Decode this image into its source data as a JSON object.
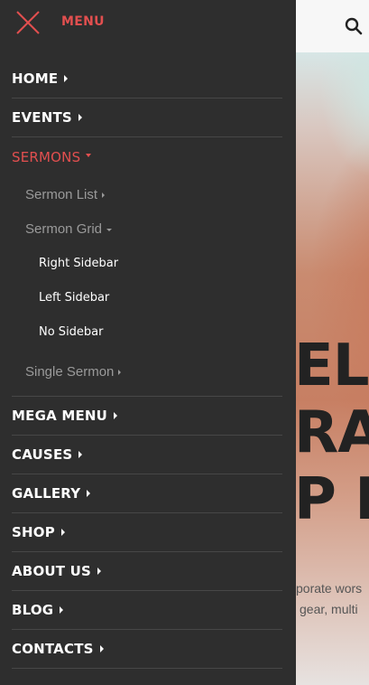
{
  "menu": {
    "title": "MENU",
    "accent_color": "#e24f4f",
    "background_color": "#2e2e2e",
    "close_icon": "close-icon",
    "items": [
      {
        "label": "HOME"
      },
      {
        "label": "EVENTS"
      },
      {
        "label": "SERMONS",
        "expanded": true,
        "children": [
          {
            "label": "Sermon List"
          },
          {
            "label": "Sermon Grid",
            "expanded": true,
            "children": [
              {
                "label": "Right Sidebar"
              },
              {
                "label": "Left Sidebar"
              },
              {
                "label": "No Sidebar"
              }
            ]
          },
          {
            "label": "Single Sermon"
          }
        ]
      },
      {
        "label": "MEGA MENU"
      },
      {
        "label": "CAUSES"
      },
      {
        "label": "GALLERY"
      },
      {
        "label": "SHOP"
      },
      {
        "label": "ABOUT US"
      },
      {
        "label": "BLOG"
      },
      {
        "label": "CONTACTS"
      }
    ]
  },
  "header": {
    "search_icon": "search-icon"
  },
  "hero": {
    "title_lines": [
      "ELL",
      "RA",
      "P L"
    ],
    "text_lines": [
      "porate wors",
      "gear, multi"
    ]
  }
}
